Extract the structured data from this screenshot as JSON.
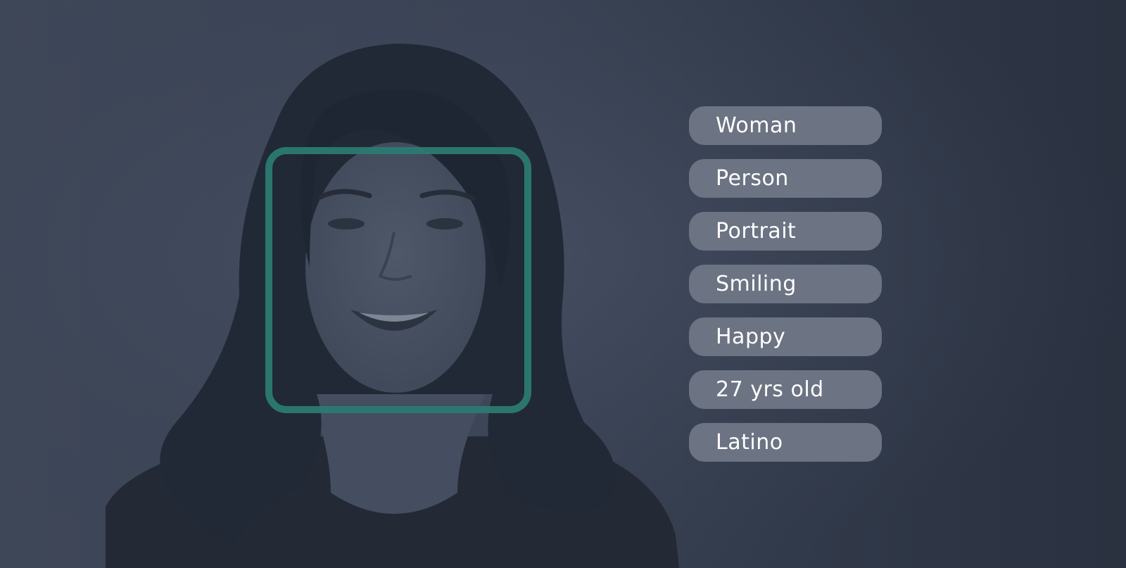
{
  "tags": [
    {
      "label": "Woman"
    },
    {
      "label": "Person"
    },
    {
      "label": "Portrait"
    },
    {
      "label": "Smiling"
    },
    {
      "label": "Happy"
    },
    {
      "label": "27 yrs old"
    },
    {
      "label": "Latino"
    }
  ],
  "colors": {
    "background": "#3a4355",
    "face_box": "#2b7a72",
    "tag_fill": "#6c7383",
    "tag_text": "#ffffff"
  }
}
